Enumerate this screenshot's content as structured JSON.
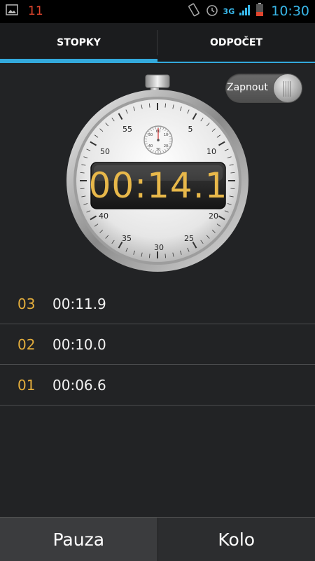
{
  "status_bar": {
    "notification_count": "11",
    "network": "3G",
    "time": "10:30"
  },
  "tabs": [
    {
      "label": "STOPKY",
      "active": true
    },
    {
      "label": "ODPOČET",
      "active": false
    }
  ],
  "toggle": {
    "label": "Zapnout"
  },
  "stopwatch": {
    "display": "00:14.1",
    "dial_labels": [
      "55",
      "5",
      "50",
      "10",
      "40",
      "20",
      "35",
      "30",
      "25"
    ],
    "subdial_labels": [
      "60",
      "10",
      "50",
      "20",
      "40",
      "30"
    ]
  },
  "laps": [
    {
      "number": "03",
      "time": "00:11.9"
    },
    {
      "number": "02",
      "time": "00:10.0"
    },
    {
      "number": "01",
      "time": "00:06.6"
    }
  ],
  "buttons": {
    "left": "Pauza",
    "right": "Kolo"
  },
  "colors": {
    "accent": "#33a9dc",
    "lap_number": "#e5ae3c",
    "digital": "#e8b84a"
  }
}
